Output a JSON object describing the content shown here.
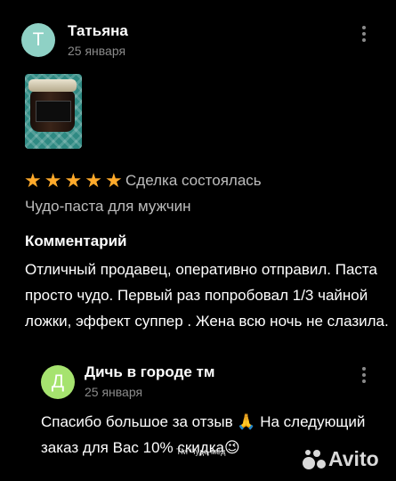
{
  "review": {
    "author": "Татьяна",
    "avatar_letter": "Т",
    "avatar_color": "#8fd1c5",
    "date": "25 января",
    "rating": 5,
    "rating_color": "#ffaa2b",
    "status": "Сделка состоялась",
    "product": "Чудо-паста для мужчин",
    "comment_heading": "Комментарий",
    "comment": "Отличный продавец, оперативно отправил. Паста просто чудо. Первый раз попробовал 1/3 чайной ложки, эффект суппер . Жена всю ночь не слазила."
  },
  "reply": {
    "author": "Дичь в городе тм",
    "avatar_letter": "Д",
    "avatar_color": "#a6e36f",
    "date": "25 января",
    "text": "Спасибо большое за отзыв 🙏 На следующий заказ для Вас 10% скидка😉"
  },
  "watermark": {
    "caption": "ТМ Чудо-мёд",
    "logo": "Avito"
  }
}
